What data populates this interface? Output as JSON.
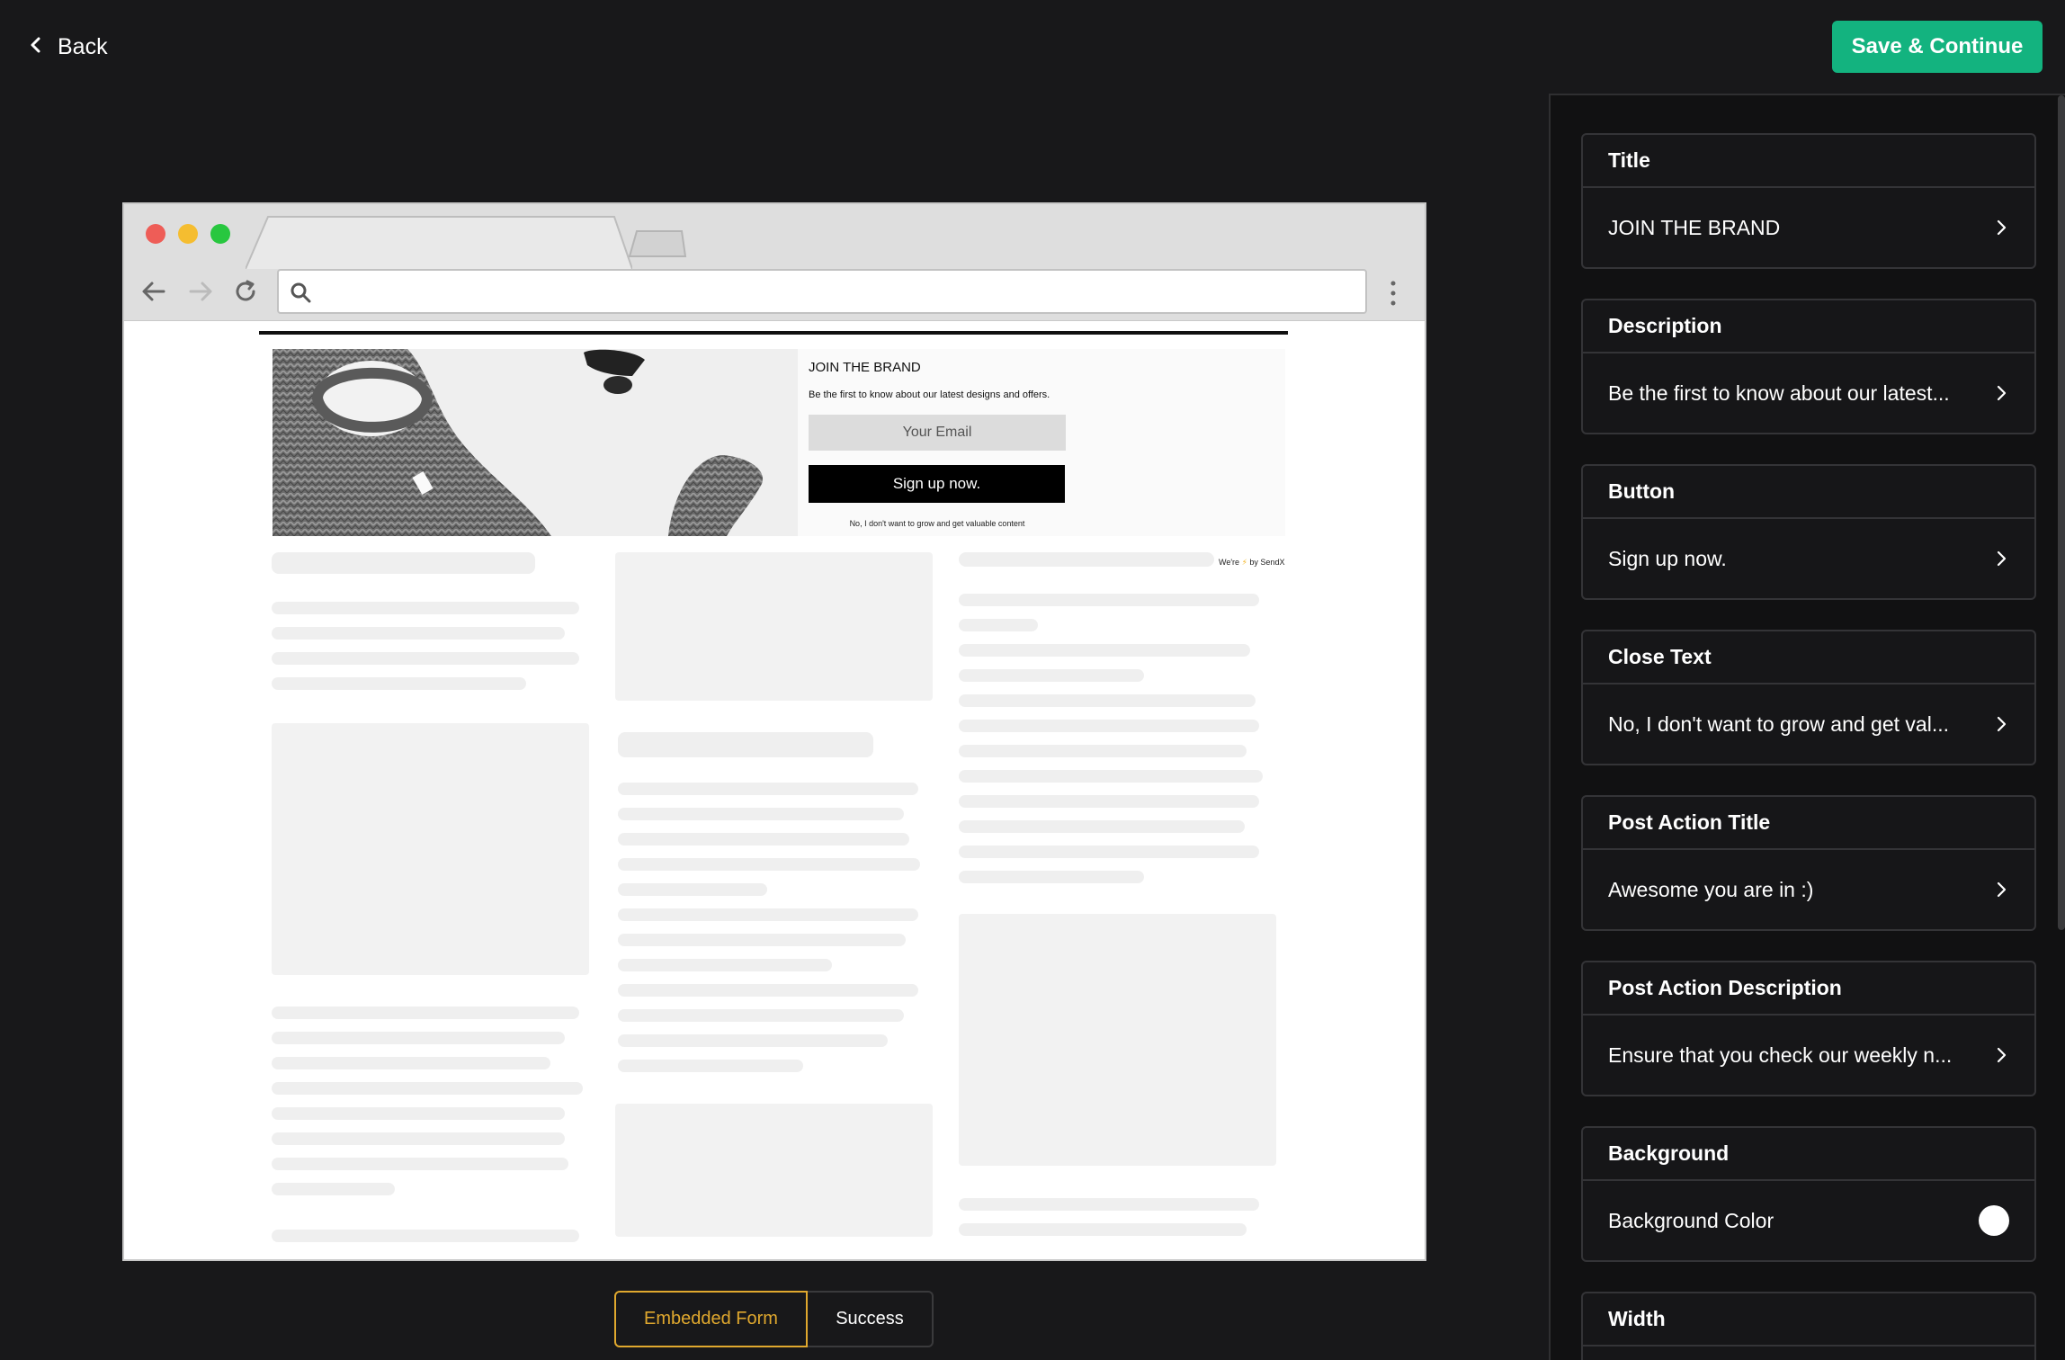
{
  "header": {
    "back_label": "Back",
    "save_label": "Save & Continue"
  },
  "preview": {
    "title": "JOIN THE BRAND",
    "description": "Be the first to know about our latest designs and offers.",
    "email_placeholder": "Your Email",
    "button_label": "Sign up now.",
    "close_text": "No, I don't want to grow and get valuable content",
    "branding_prefix": "We're",
    "branding_suffix": "by SendX"
  },
  "tabs": [
    {
      "label": "Embedded Form",
      "active": true
    },
    {
      "label": "Success",
      "active": false
    }
  ],
  "settings": [
    {
      "heading": "Title",
      "value": "JOIN THE BRAND"
    },
    {
      "heading": "Description",
      "value": "Be the first to know about our latest..."
    },
    {
      "heading": "Button",
      "value": "Sign up now."
    },
    {
      "heading": "Close Text",
      "value": "No, I don't want to grow and get val..."
    },
    {
      "heading": "Post Action Title",
      "value": "Awesome you are in :)"
    },
    {
      "heading": "Post Action Description",
      "value": "Ensure that you check our weekly n..."
    },
    {
      "heading": "Background",
      "value": "Background Color"
    },
    {
      "heading": "Width",
      "value": ""
    }
  ],
  "colors": {
    "accent": "#13b37f",
    "active_tab": "#e0a82e",
    "background_swatch": "#ffffff"
  }
}
